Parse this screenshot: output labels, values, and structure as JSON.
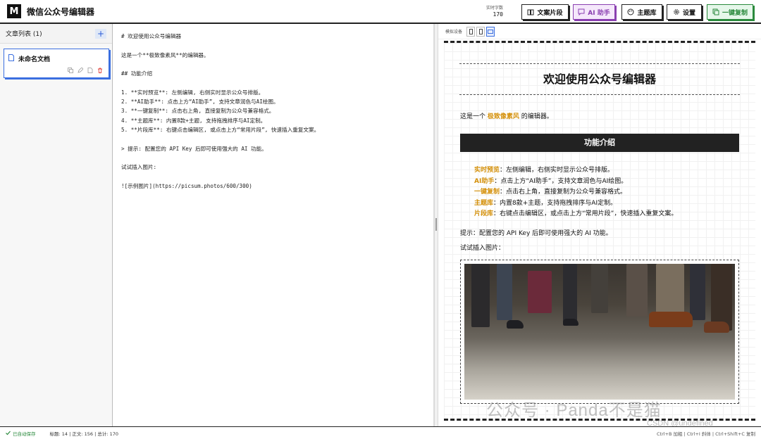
{
  "header": {
    "logo": "M",
    "title": "微信公众号编辑器",
    "word_count_label": "实时字数",
    "word_count": "170",
    "buttons": {
      "snippets": "文案片段",
      "ai": "AI 助手",
      "themes": "主题库",
      "settings": "设置",
      "copy": "一键复制"
    }
  },
  "sidebar": {
    "title": "文章列表 (1)",
    "add": "+",
    "documents": [
      {
        "name": "未命名文档"
      }
    ]
  },
  "editor": {
    "content": "# 欢迎使用公众号编辑器\n\n这是一个**极致像素风**的编辑器。\n\n## 功能介绍\n\n1. **实时预览**: 左侧编辑, 右侧实时显示公众号排版。\n2. **AI助手**: 点击上方“AI助手”, 支持文章润色与AI绘图。\n3. **一键复制**: 点击右上角, 直接复制为公众号兼容格式。\n4. **主题库**: 内置8款+主题, 支持拖拽排序与AI定制。\n5. **片段库**: 右键点击编辑区, 或点击上方“常用片段”, 快速插入重复文案。\n\n> 提示: 配置您的 API Key 后即可使用强大的 AI 功能。\n\n试试插入图片:\n\n![示例图片](https://picsum.photos/600/300)"
  },
  "preview": {
    "device_label": "模拟设备",
    "h1": "欢迎使用公众号编辑器",
    "intro_before": "这是一个 ",
    "intro_highlight": "极致像素风",
    "intro_after": " 的编辑器。",
    "h2": "功能介绍",
    "features": [
      {
        "key": "实时预览",
        "text": "：左侧编辑，右侧实时显示公众号排版。"
      },
      {
        "key": "AI助手",
        "text": "：点击上方“AI助手”，支持文章润色与AI绘图。"
      },
      {
        "key": "一键复制",
        "text": "：点击右上角，直接复制为公众号兼容格式。"
      },
      {
        "key": "主题库",
        "text": "：内置8款+主题，支持拖拽排序与AI定制。"
      },
      {
        "key": "片段库",
        "text": "：右键点击编辑区，或点击上方“常用片段”，快速插入重复文案。"
      }
    ],
    "tip": "提示：配置您的 API Key 后即可使用强大的 AI 功能。",
    "try_image": "试试插入图片："
  },
  "status": {
    "saved": "已自动保存",
    "stats": "标题: 14  |  正文: 156  |  总计: 170",
    "shortcuts": "Ctrl+B 加粗  |  Ctrl+I 斜体  |  Ctrl+Shift+C 复制"
  },
  "watermarks": {
    "main": "公众号 · Panda不是猫",
    "sub": "CSDN @undefined"
  },
  "colors": {
    "accent_blue": "#3b6fe0",
    "highlight_orange": "#d4900a",
    "ai_purple": "#8a3fb0",
    "copy_green": "#2a8a3c"
  }
}
